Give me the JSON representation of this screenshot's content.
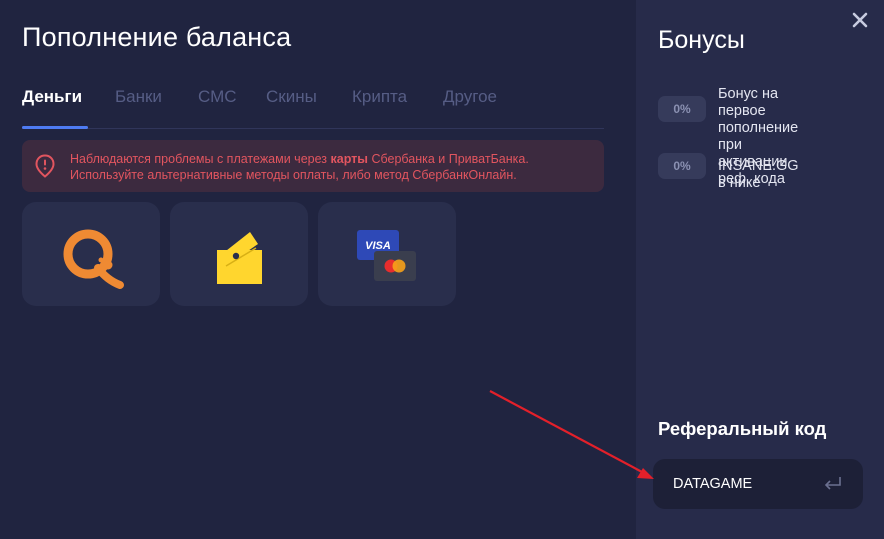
{
  "header": {
    "title": "Пополнение баланса"
  },
  "tabs": [
    {
      "label": "Деньги",
      "active": true
    },
    {
      "label": "Банки",
      "active": false
    },
    {
      "label": "СМС",
      "active": false
    },
    {
      "label": "Скины",
      "active": false
    },
    {
      "label": "Крипта",
      "active": false
    },
    {
      "label": "Другое",
      "active": false
    }
  ],
  "alert": {
    "icon": "warning-pin-icon",
    "line1_prefix": "Наблюдаются проблемы с платежами через ",
    "line1_bold": "карты",
    "line1_suffix": " Сбербанка и ПриватБанка.",
    "line2": "Используйте альтернативные методы оплаты, либо метод СбербанкОнлайн.",
    "color": "#e2555f"
  },
  "payment_methods": [
    {
      "icon": "qiwi-logo-icon"
    },
    {
      "icon": "yoomoney-wallet-icon"
    },
    {
      "icon": "visa-mastercard-icon",
      "visa_label": "VISA"
    }
  ],
  "bonuses": {
    "title": "Бонусы",
    "items": [
      {
        "badge": "0%",
        "line1": "Бонус на первое",
        "line2": "пополнение при",
        "line3": "активации реф. кода"
      },
      {
        "badge": "0%",
        "line1": "INSANE.GG в нике"
      }
    ]
  },
  "referral": {
    "title": "Реферальный код",
    "value": "DATAGAME",
    "submit_icon": "enter-arrow-icon"
  },
  "close_icon": "close-icon",
  "annotation": {
    "color": "#e3202a"
  },
  "colors": {
    "background": "#202440",
    "sidebar": "#272b4a",
    "accent": "#4e7bf2",
    "card": "#292e4c"
  }
}
